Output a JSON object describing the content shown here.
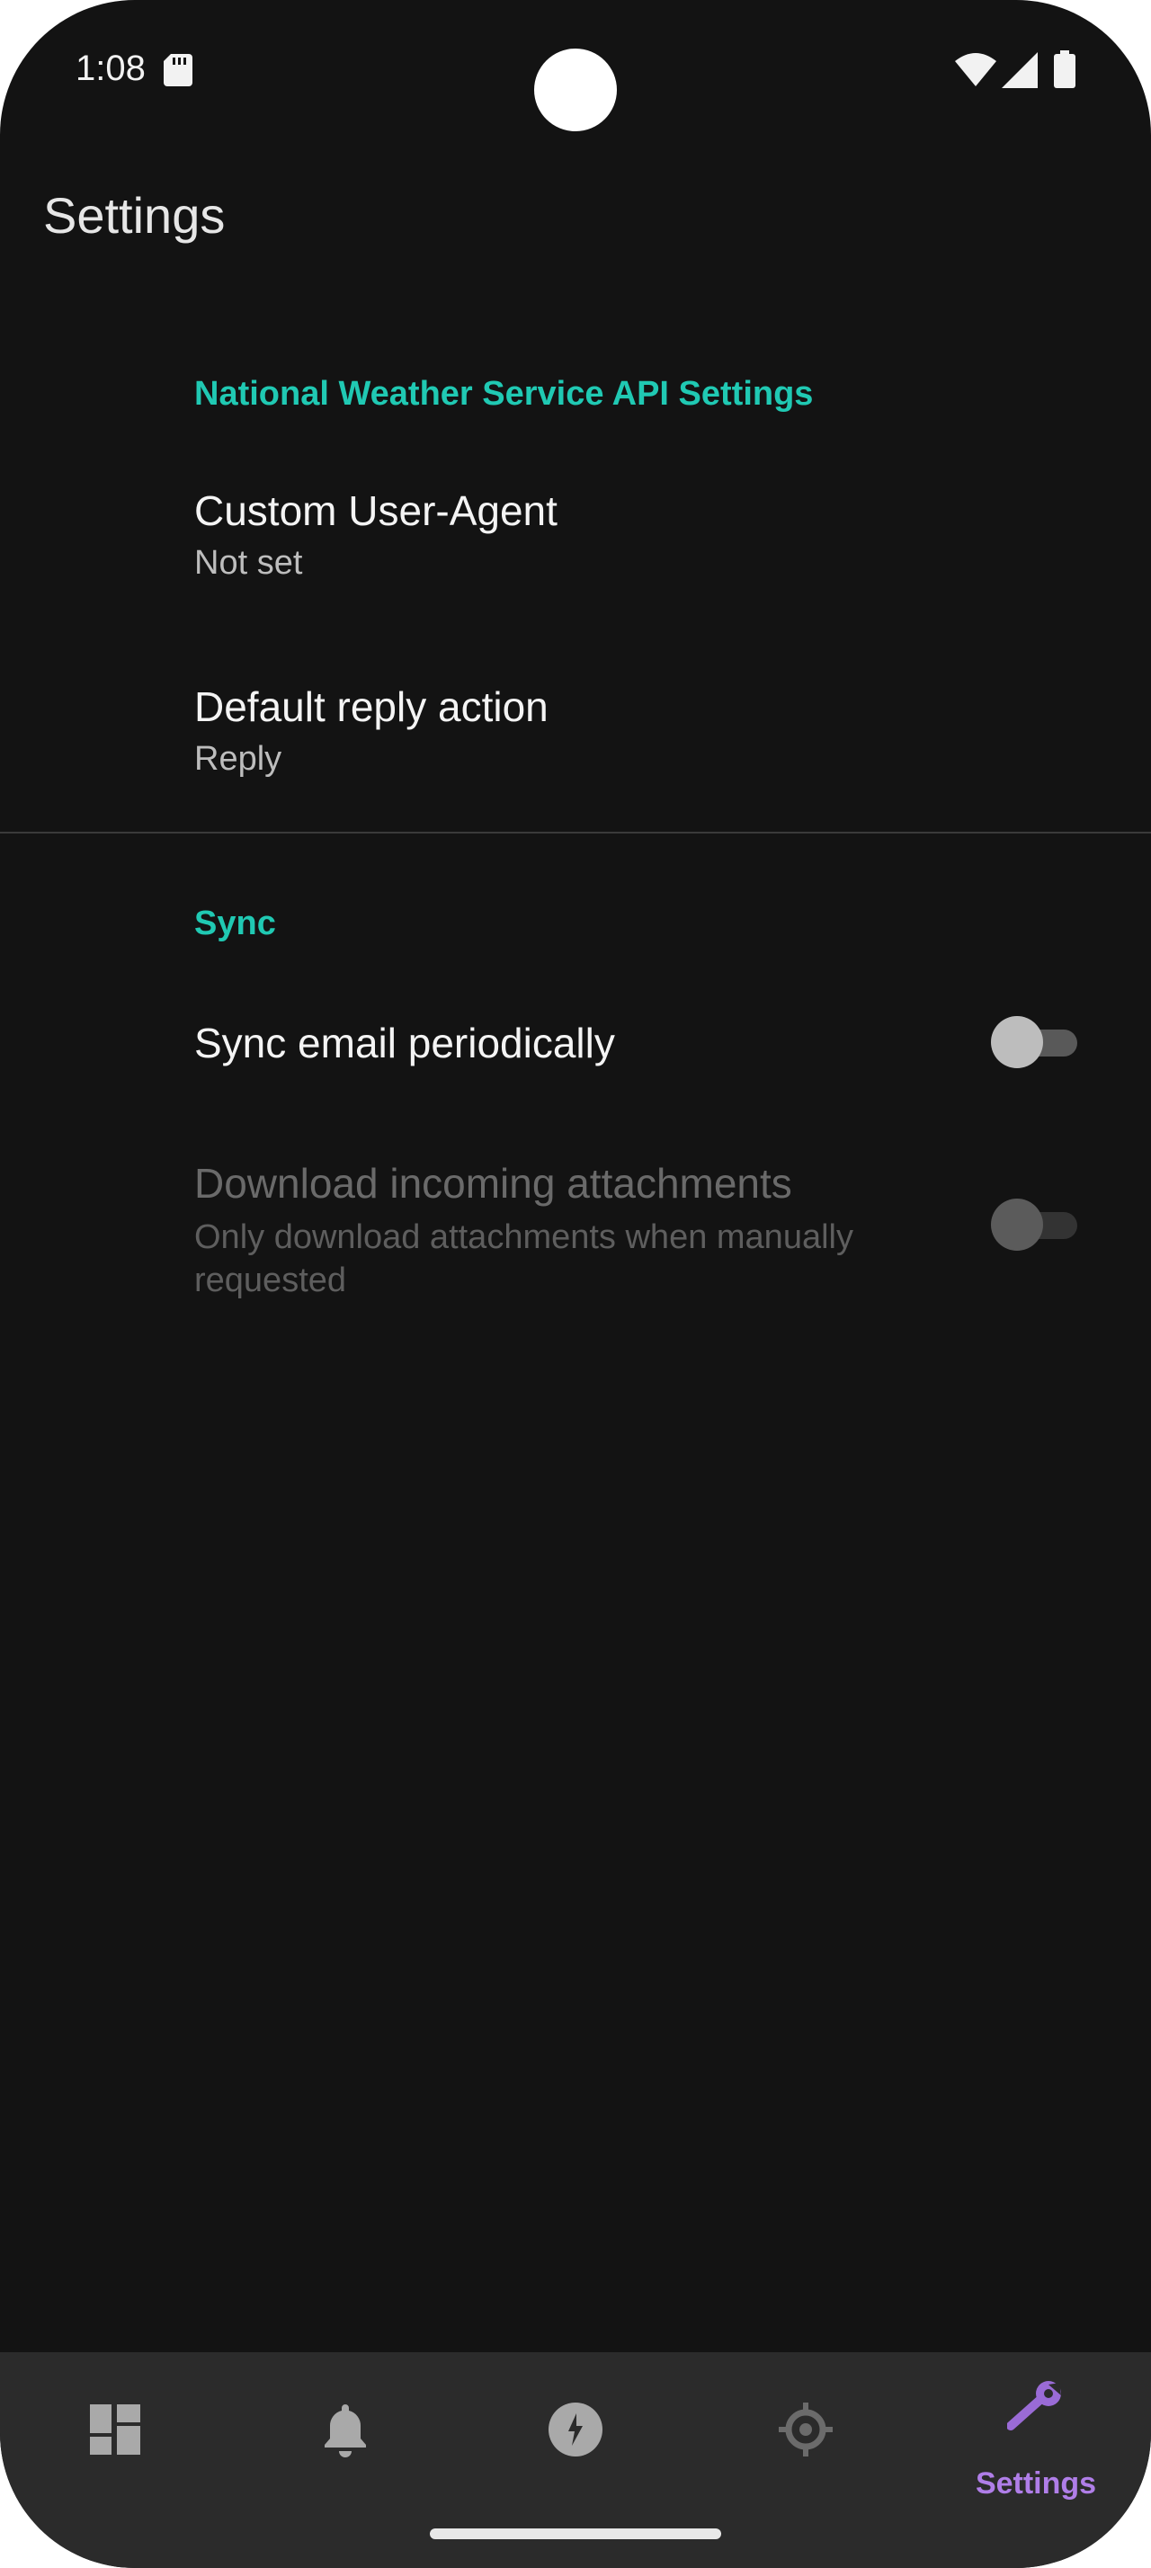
{
  "status_bar": {
    "time": "1:08",
    "icons": [
      "sd-card-icon",
      "wifi-icon",
      "cell-signal-icon",
      "battery-icon"
    ]
  },
  "page": {
    "title": "Settings"
  },
  "sections": [
    {
      "header": "National Weather Service API Settings",
      "items": [
        {
          "title": "Custom User-Agent",
          "summary": "Not set"
        },
        {
          "title": "Default reply action",
          "summary": "Reply"
        }
      ]
    },
    {
      "header": "Sync",
      "items": [
        {
          "title": "Sync email periodically",
          "switch_on": false,
          "enabled": true
        },
        {
          "title": "Download incoming attachments",
          "summary": "Only download attachments when manually requested",
          "switch_on": false,
          "enabled": false
        }
      ]
    }
  ],
  "bottom_nav": {
    "items": [
      {
        "icon": "dashboard-icon",
        "label": ""
      },
      {
        "icon": "bell-icon",
        "label": ""
      },
      {
        "icon": "storm-icon",
        "label": ""
      },
      {
        "icon": "radar-icon",
        "label": ""
      },
      {
        "icon": "wrench-icon",
        "label": "Settings",
        "active": true
      }
    ]
  },
  "colors": {
    "background": "#131313",
    "accent_section": "#20c9b3",
    "accent_nav": "#b07ee8",
    "nav_background": "#2b2b2b"
  }
}
